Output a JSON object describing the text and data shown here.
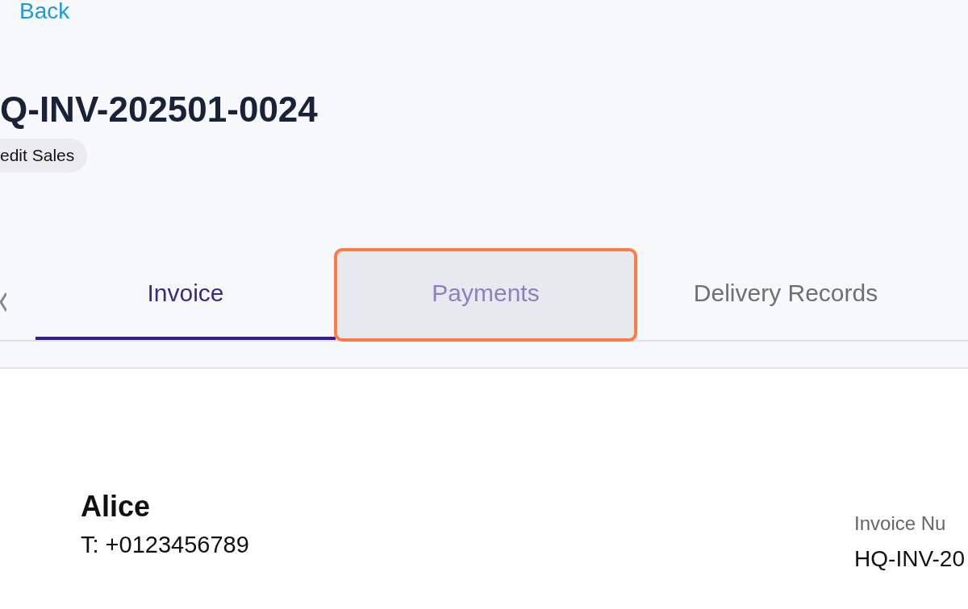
{
  "back_link": "Back",
  "title": "Q-INV-202501-0024",
  "tag": "edit Sales",
  "tabs": [
    {
      "label": "Invoice",
      "selected": true,
      "hovered": false,
      "highlighted": false
    },
    {
      "label": "Payments",
      "selected": false,
      "hovered": true,
      "highlighted": true
    },
    {
      "label": "Delivery Records",
      "selected": false,
      "hovered": false,
      "highlighted": false
    }
  ],
  "customer": {
    "name": "Alice",
    "phone": "T: +0123456789"
  },
  "invoice_meta": {
    "label": "Invoice Nu",
    "value": "HQ-INV-20"
  }
}
